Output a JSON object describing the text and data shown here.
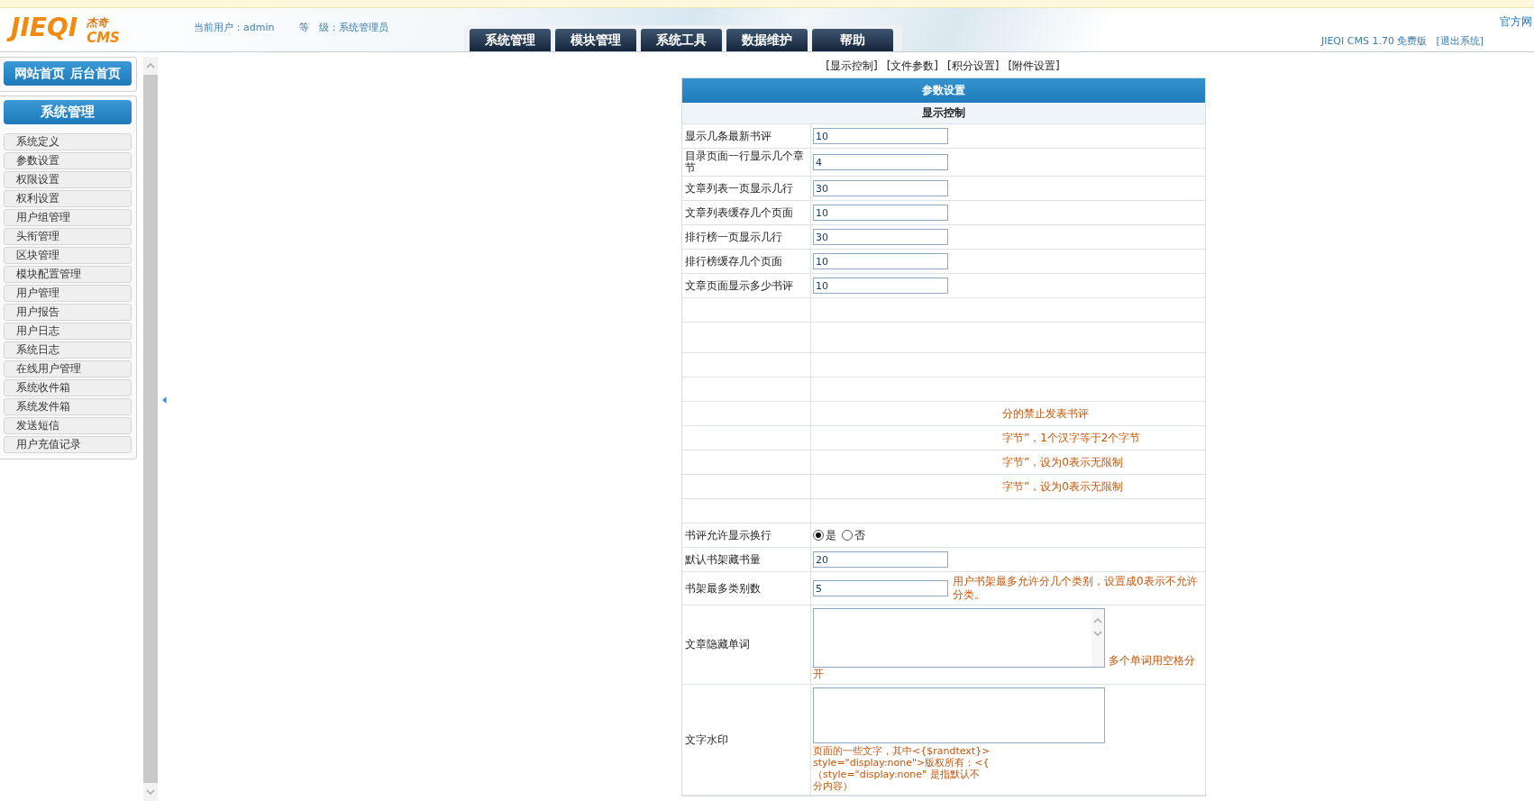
{
  "header": {
    "logo": {
      "mark": "JIEQI",
      "sub_top": "杰奇",
      "sub_bottom": "CMS"
    },
    "user": "当前用户：admin",
    "level": "等　级：系统管理员",
    "nav": [
      "系统管理",
      "模块管理",
      "系统工具",
      "数据维护",
      "帮助"
    ],
    "site_link": "官方网",
    "version": "JIEQI CMS 1.70 免费版",
    "logout": "[退出系统]"
  },
  "sidebar": {
    "quick_links": [
      "网站首页",
      "后台首页"
    ],
    "section_title": "系统管理",
    "items": [
      "系统定义",
      "参数设置",
      "权限设置",
      "权利设置",
      "用户组管理",
      "头衔管理",
      "区块管理",
      "模块配置管理",
      "用户管理",
      "用户报告",
      "用户日志",
      "系统日志",
      "在线用户管理",
      "系统收件箱",
      "系统发件箱",
      "发送短信",
      "用户充值记录"
    ]
  },
  "main": {
    "section_links": [
      "[显示控制]",
      "[文件参数]",
      "[积分设置]",
      "[附件设置]"
    ],
    "title": "参数设置",
    "group": "显示控制",
    "rows": [
      {
        "kind": "input",
        "label": "显示几条最新书评",
        "value": "10"
      },
      {
        "kind": "input",
        "label": "目录页面一行显示几个章节",
        "value": "4"
      },
      {
        "kind": "input",
        "label": "文章列表一页显示几行",
        "value": "30"
      },
      {
        "kind": "input",
        "label": "文章列表缓存几个页面",
        "value": "10"
      },
      {
        "kind": "input",
        "label": "排行榜一页显示几行",
        "value": "30"
      },
      {
        "kind": "input",
        "label": "排行榜缓存几个页面",
        "value": "10"
      },
      {
        "kind": "input",
        "label": "文章页面显示多少书评",
        "value": "10"
      },
      {
        "kind": "blank"
      },
      {
        "kind": "blank",
        "tall": true
      },
      {
        "kind": "blank"
      },
      {
        "kind": "blank"
      },
      {
        "kind": "blank",
        "note": "分的禁止发表书评"
      },
      {
        "kind": "blank",
        "note": "字节”，1个汉字等于2个字节"
      },
      {
        "kind": "blank",
        "note": "字节”，设为0表示无限制"
      },
      {
        "kind": "blank",
        "note": "字节”，设为0表示无限制"
      },
      {
        "kind": "blank"
      },
      {
        "kind": "radio",
        "label": "书评允许显示换行",
        "options": [
          {
            "label": "是",
            "selected": true
          },
          {
            "label": "否",
            "selected": false
          }
        ]
      },
      {
        "kind": "input",
        "label": "默认书架藏书量",
        "value": "20"
      },
      {
        "kind": "input",
        "label": "书架最多类别数",
        "value": "5",
        "note": "用户书架最多允许分几个类别，设置成0表示不允许分类。"
      },
      {
        "kind": "textarea",
        "label": "文章隐藏单词",
        "note": "多个单词用空格分开"
      },
      {
        "kind": "textarea",
        "label": "文字水印",
        "note_lines": [
          "页面的一些文字，其中<{$randtext}>",
          "style=\"display:none\">版权所有：<{",
          "（style=\"display:none\" 是指默认不",
          "分内容）"
        ]
      }
    ]
  }
}
